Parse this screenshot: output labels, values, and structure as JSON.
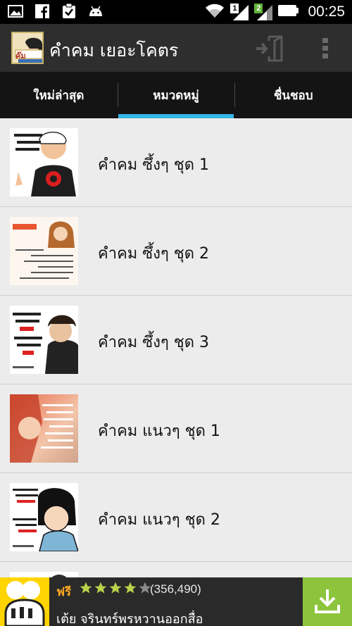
{
  "statusbar": {
    "icons_left": [
      "image-icon",
      "facebook-icon",
      "clipboard-check-icon",
      "android-icon"
    ],
    "sim1_label": "1",
    "sim2_label": "2",
    "time": "00:25"
  },
  "actionbar": {
    "logo_text": "ค๊ม",
    "title": "คำคม เยอะโคตร"
  },
  "tabs": [
    {
      "label": "ใหม่ล่าสุด",
      "active": false
    },
    {
      "label": "หมวดหมู่",
      "active": true
    },
    {
      "label": "ชื่นชอบ",
      "active": false
    }
  ],
  "list": [
    {
      "label": "คำคม ซึ้งๆ ชุด 1"
    },
    {
      "label": "คำคม ซึ้งๆ ชุด 2"
    },
    {
      "label": "คำคม ซึ้งๆ ชุด 3"
    },
    {
      "label": "คำคม แนวๆ ชุด 1"
    },
    {
      "label": "คำคม แนวๆ ชุด 2"
    },
    {
      "label": ""
    }
  ],
  "ad": {
    "free_label": "ฟรี",
    "rating_stars": 4,
    "rating_count": "(356,490)",
    "title": "เต้ย จรินทร์พรหวานออกสื่อ"
  },
  "colors": {
    "accent": "#33b5e5",
    "download_green": "#8cc43c",
    "ad_yellow": "#ffd400"
  }
}
